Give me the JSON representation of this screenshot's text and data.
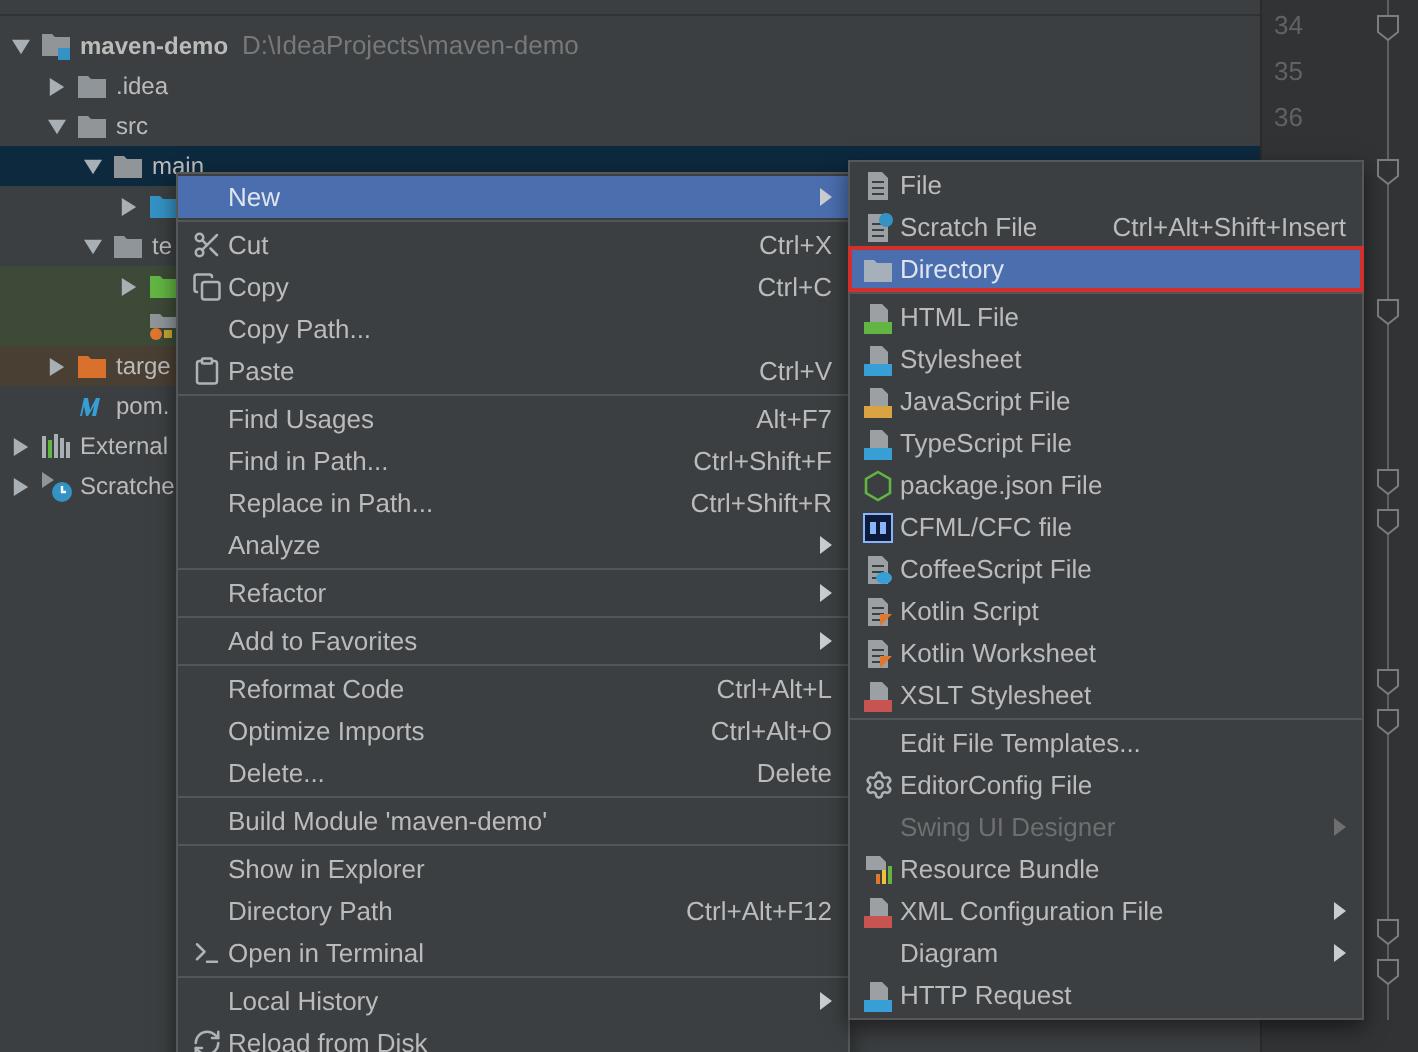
{
  "tree": [
    {
      "label": "maven-demo",
      "path": "D:\\IdeaProjects\\maven-demo",
      "expanded": true,
      "selected": false,
      "children": [
        {
          "label": ".idea",
          "expanded": false,
          "selected": false
        },
        {
          "label": "src",
          "expanded": true,
          "selected": false,
          "children": [
            {
              "label": "main",
              "expanded": true,
              "selected": true,
              "children": [
                {
                  "expanded": false,
                  "selected": false
                }
              ]
            },
            {
              "label": "te",
              "expanded": true,
              "selected": false,
              "children": [
                {
                  "expanded": false,
                  "selected": false,
                  "color": "#3d4a38"
                },
                {
                  "selected": false,
                  "color": "#3d4a38"
                }
              ]
            }
          ]
        },
        {
          "label": "targe",
          "expanded": false,
          "selected": false,
          "color": "#4a3f33"
        },
        {
          "label": "pom.",
          "selected": false
        }
      ]
    },
    {
      "label": "External",
      "expanded": false,
      "selected": false
    },
    {
      "label": "Scratche",
      "expanded": false,
      "selected": false
    }
  ],
  "line_numbers": [
    "34",
    "35",
    "36"
  ],
  "context_menu": [
    {
      "kind": "item",
      "label": "New",
      "submenu": true,
      "selected": true
    },
    {
      "kind": "separator"
    },
    {
      "kind": "item",
      "label": "Cut",
      "shortcut": "Ctrl+X",
      "selected": false
    },
    {
      "kind": "item",
      "label": "Copy",
      "shortcut": "Ctrl+C",
      "selected": false
    },
    {
      "kind": "item",
      "label": "Copy Path...",
      "selected": false
    },
    {
      "kind": "item",
      "label": "Paste",
      "shortcut": "Ctrl+V",
      "selected": false
    },
    {
      "kind": "separator"
    },
    {
      "kind": "item",
      "label": "Find Usages",
      "shortcut": "Alt+F7",
      "selected": false
    },
    {
      "kind": "item",
      "label": "Find in Path...",
      "shortcut": "Ctrl+Shift+F",
      "selected": false
    },
    {
      "kind": "item",
      "label": "Replace in Path...",
      "shortcut": "Ctrl+Shift+R",
      "selected": false
    },
    {
      "kind": "item",
      "label": "Analyze",
      "submenu": true,
      "selected": false
    },
    {
      "kind": "separator"
    },
    {
      "kind": "item",
      "label": "Refactor",
      "submenu": true,
      "selected": false
    },
    {
      "kind": "separator"
    },
    {
      "kind": "item",
      "label": "Add to Favorites",
      "submenu": true,
      "selected": false
    },
    {
      "kind": "separator"
    },
    {
      "kind": "item",
      "label": "Reformat Code",
      "shortcut": "Ctrl+Alt+L",
      "selected": false
    },
    {
      "kind": "item",
      "label": "Optimize Imports",
      "shortcut": "Ctrl+Alt+O",
      "selected": false
    },
    {
      "kind": "item",
      "label": "Delete...",
      "shortcut": "Delete",
      "selected": false
    },
    {
      "kind": "separator"
    },
    {
      "kind": "item",
      "label": "Build Module 'maven-demo'",
      "selected": false
    },
    {
      "kind": "separator"
    },
    {
      "kind": "item",
      "label": "Show in Explorer",
      "selected": false
    },
    {
      "kind": "item",
      "label": "Directory Path",
      "shortcut": "Ctrl+Alt+F12",
      "selected": false
    },
    {
      "kind": "item",
      "label": "Open in Terminal",
      "selected": false
    },
    {
      "kind": "separator"
    },
    {
      "kind": "item",
      "label": "Local History",
      "submenu": true,
      "selected": false
    },
    {
      "kind": "item",
      "label": "Reload from Disk",
      "selected": false
    }
  ],
  "new_submenu": [
    {
      "kind": "item",
      "label": "File",
      "selected": false
    },
    {
      "kind": "item",
      "label": "Scratch File",
      "shortcut": "Ctrl+Alt+Shift+Insert",
      "selected": false
    },
    {
      "kind": "item",
      "label": "Directory",
      "selected": true,
      "outlined": true
    },
    {
      "kind": "separator"
    },
    {
      "kind": "item",
      "label": "HTML File",
      "selected": false
    },
    {
      "kind": "item",
      "label": "Stylesheet",
      "selected": false
    },
    {
      "kind": "item",
      "label": "JavaScript File",
      "selected": false
    },
    {
      "kind": "item",
      "label": "TypeScript File",
      "selected": false
    },
    {
      "kind": "item",
      "label": "package.json File",
      "selected": false
    },
    {
      "kind": "item",
      "label": "CFML/CFC file",
      "selected": false
    },
    {
      "kind": "item",
      "label": "CoffeeScript File",
      "selected": false
    },
    {
      "kind": "item",
      "label": "Kotlin Script",
      "selected": false
    },
    {
      "kind": "item",
      "label": "Kotlin Worksheet",
      "selected": false
    },
    {
      "kind": "item",
      "label": "XSLT Stylesheet",
      "selected": false
    },
    {
      "kind": "separator"
    },
    {
      "kind": "item",
      "label": "Edit File Templates...",
      "selected": false
    },
    {
      "kind": "item",
      "label": "EditorConfig File",
      "selected": false
    },
    {
      "kind": "item",
      "label": "Swing UI Designer",
      "submenu": true,
      "disabled": true,
      "selected": false
    },
    {
      "kind": "item",
      "label": "Resource Bundle",
      "selected": false
    },
    {
      "kind": "item",
      "label": "XML Configuration File",
      "submenu": true,
      "selected": false
    },
    {
      "kind": "item",
      "label": "Diagram",
      "submenu": true,
      "selected": false
    },
    {
      "kind": "item",
      "label": "HTTP Request",
      "selected": false
    }
  ]
}
